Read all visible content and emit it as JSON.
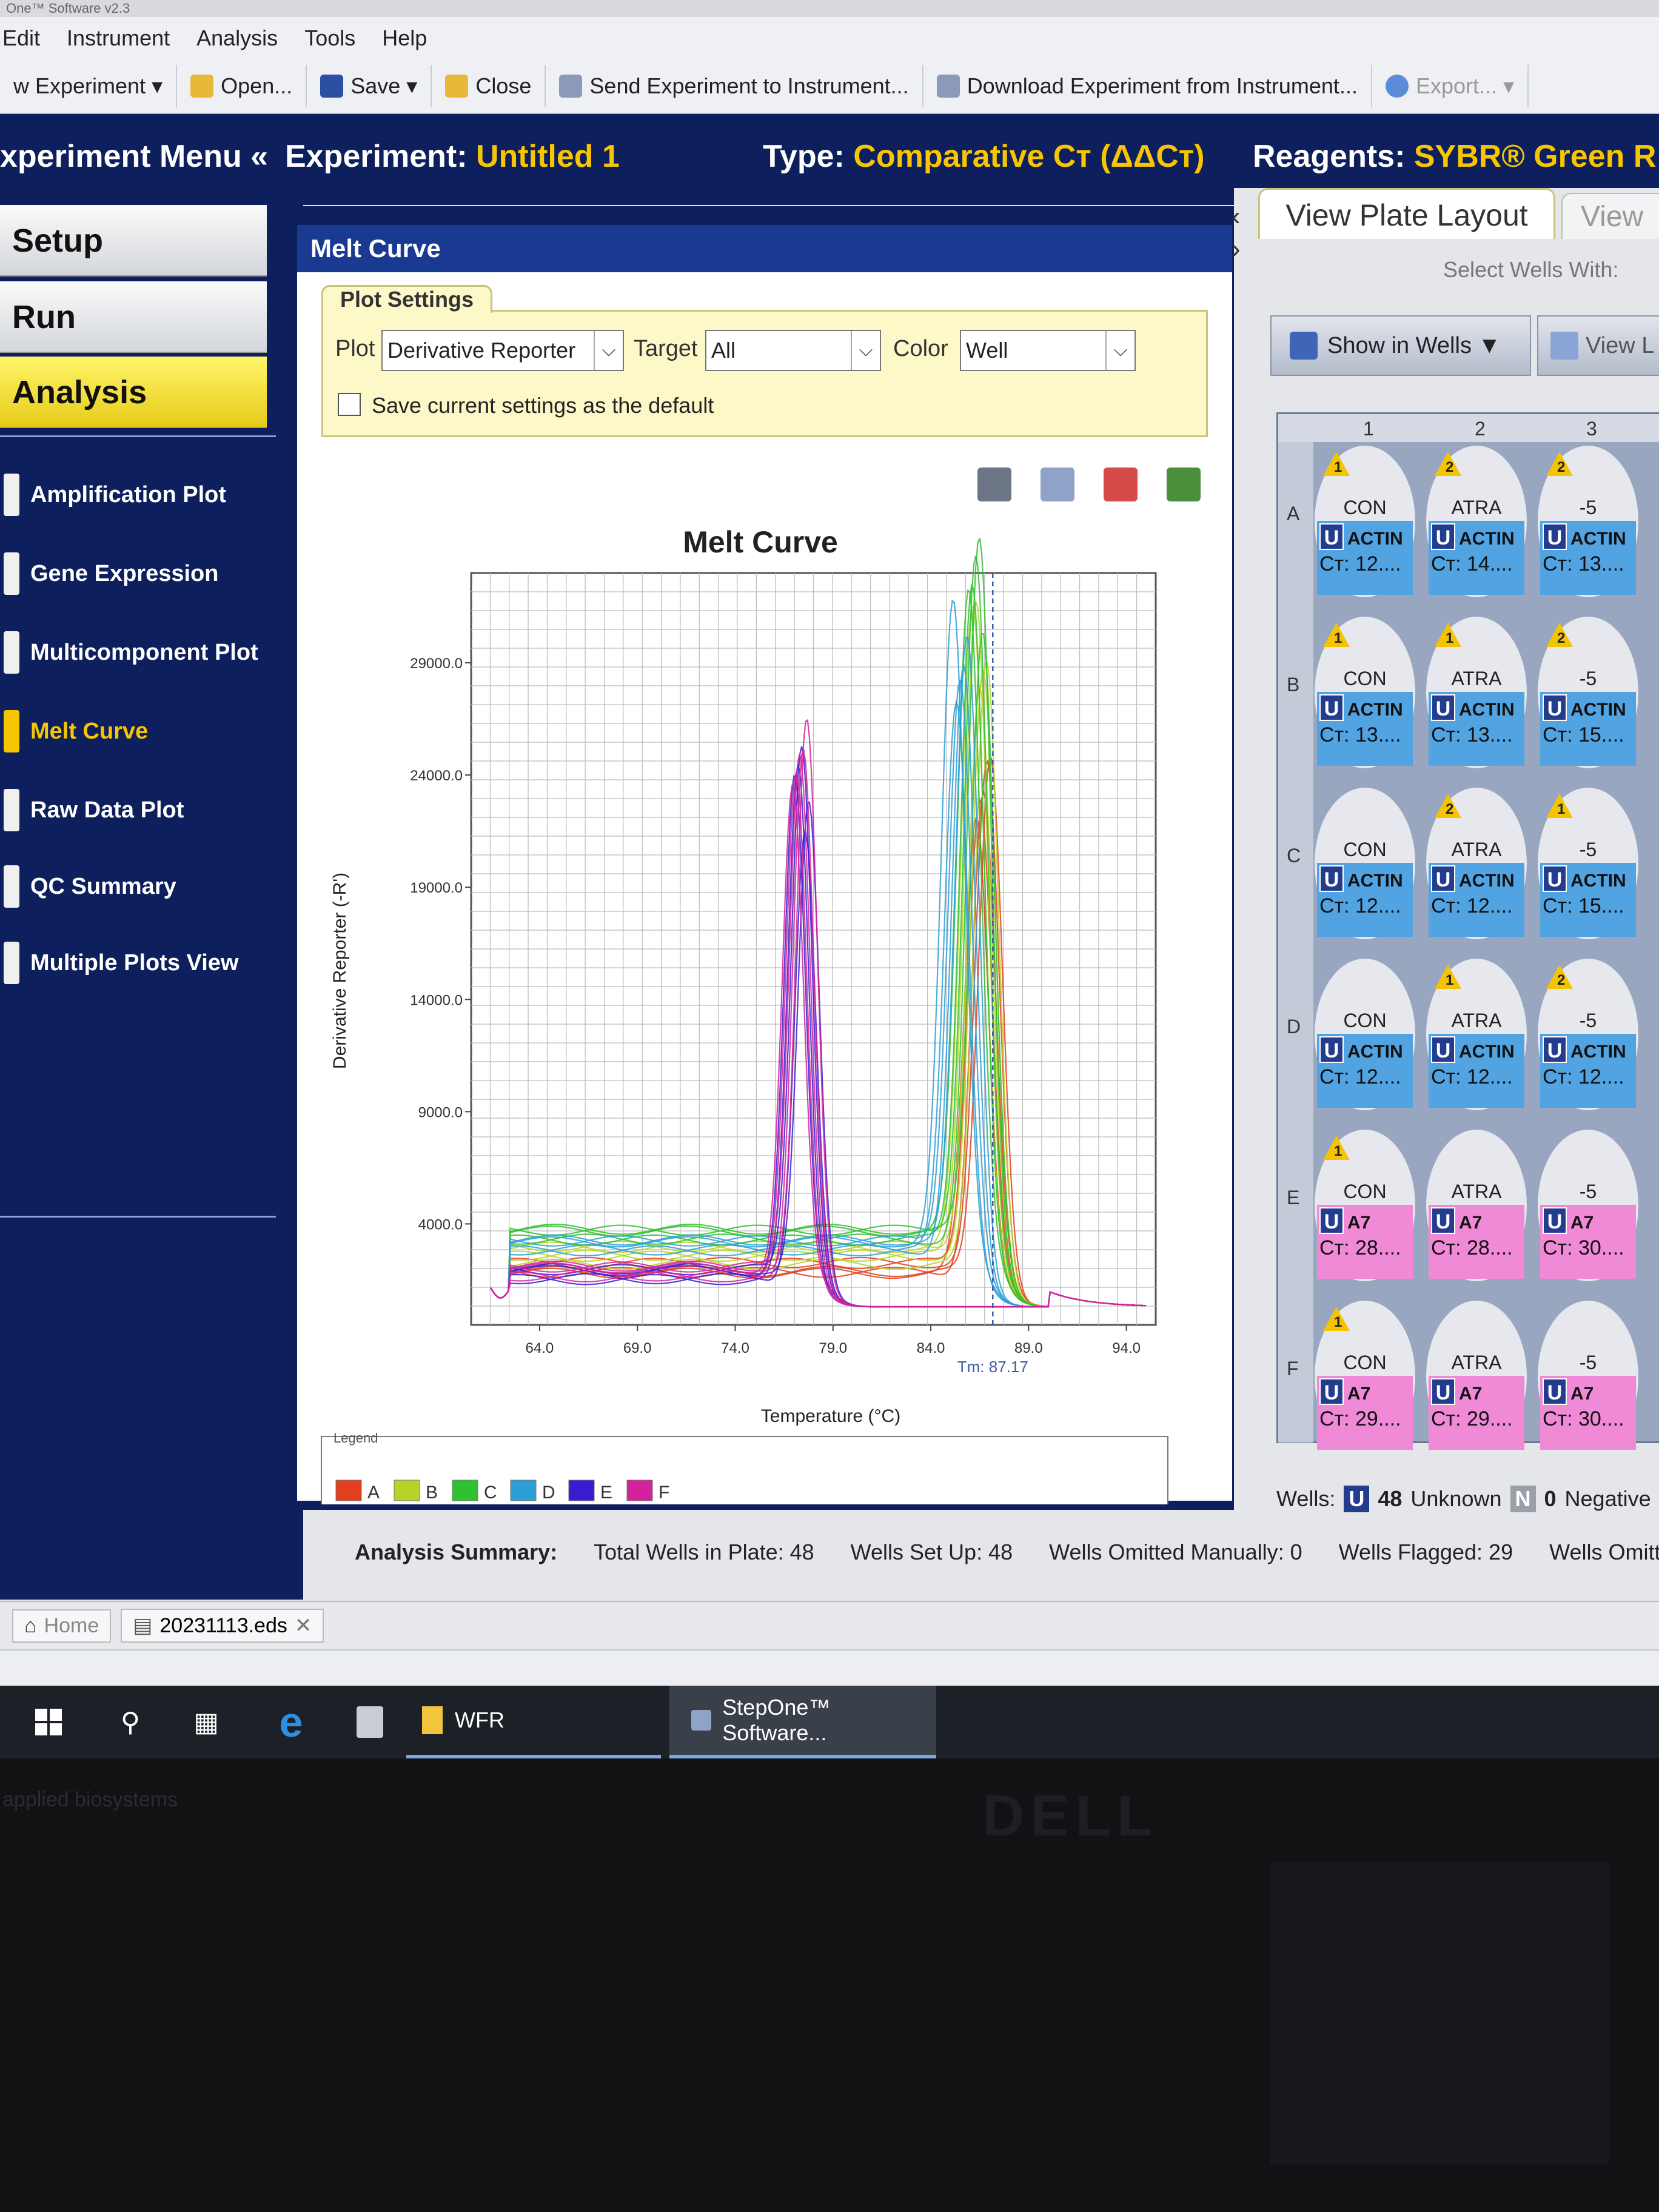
{
  "app": {
    "title": "One™ Software v2.3"
  },
  "menu": [
    "Edit",
    "Instrument",
    "Analysis",
    "Tools",
    "Help"
  ],
  "toolbar": {
    "new_experiment": "w Experiment ▾",
    "open": "Open...",
    "save": "Save ▾",
    "close": "Close",
    "send": "Send Experiment to Instrument...",
    "download": "Download Experiment from Instrument...",
    "export": "Export... ▾"
  },
  "header": {
    "experiment_menu": "xperiment Menu «",
    "experiment_label": "Experiment:",
    "experiment_name": "Untitled 1",
    "type_label": "Type:",
    "type_value": "Comparative Cт (ΔΔCт)",
    "reagents_label": "Reagents:",
    "reagents_value": "SYBR® Green R"
  },
  "sidebar": {
    "nav": [
      "Setup",
      "Run",
      "Analysis"
    ],
    "analysis": [
      "Amplification Plot",
      "Gene Expression",
      "Multicomponent Plot",
      "Melt Curve",
      "Raw Data Plot",
      "QC Summary",
      "Multiple Plots View"
    ],
    "collapse": "«"
  },
  "panel": {
    "title": "Melt Curve",
    "plot_settings": {
      "label": "Plot Settings",
      "plot_label": "Plot",
      "plot_value": "Derivative Reporter",
      "target_label": "Target",
      "target_value": "All",
      "color_label": "Color",
      "color_value": "Well",
      "save_default": "Save current settings as the default"
    }
  },
  "chart_data": {
    "type": "line",
    "title": "Melt Curve",
    "xlabel": "Temperature (°C)",
    "ylabel": "Derivative Reporter (-R')",
    "xlim": [
      60.5,
      95.5
    ],
    "ylim": [
      -500,
      33000
    ],
    "xticks": [
      64.0,
      69.0,
      74.0,
      79.0,
      84.0,
      89.0,
      94.0
    ],
    "xtick_labels": [
      "64.0",
      "69.0",
      "74.0",
      "79.0",
      "84.0",
      "89.0",
      "94.0"
    ],
    "yticks": [
      4000,
      9000,
      14000,
      19000,
      24000,
      29000
    ],
    "ytick_labels": [
      "4000.0",
      "9000.0",
      "14000.0",
      "19000.0",
      "24000.0",
      "29000.0"
    ],
    "grid": true,
    "tm_marker": {
      "x": 87.17,
      "label": "Tm: 87.17"
    },
    "legend": {
      "title": "Legend",
      "position": "bottom"
    },
    "series": [
      {
        "name": "A",
        "color": "#e0401e",
        "peak_temp": 86.7,
        "peak_height": 24000,
        "baseline": 2200
      },
      {
        "name": "B",
        "color": "#b7d32a",
        "peak_temp": 86.5,
        "peak_height": 30000,
        "baseline": 2600
      },
      {
        "name": "C",
        "color": "#2fc12f",
        "peak_temp": 86.3,
        "peak_height": 32000,
        "baseline": 3400
      },
      {
        "name": "D",
        "color": "#2b9fd6",
        "peak_temp": 85.5,
        "peak_height": 28500,
        "baseline": 3000
      },
      {
        "name": "E",
        "color": "#3a1cd0",
        "peak_temp": 77.4,
        "peak_height": 23500,
        "baseline": 1800
      },
      {
        "name": "F",
        "color": "#d4229c",
        "peak_temp": 77.3,
        "peak_height": 24500,
        "baseline": 2000
      }
    ]
  },
  "plate": {
    "tab_active": "View Plate Layout",
    "tab_inactive": "View",
    "select_wells": "Select Wells With:",
    "show_in_wells": "Show in Wells ▼",
    "view_legend": "View L",
    "columns": [
      "1",
      "2",
      "3"
    ],
    "rows": [
      {
        "label": "A",
        "wells": [
          {
            "flag": "1",
            "sample": "CON",
            "target": "ACTIN",
            "ct": "Cт: 12....",
            "color": "#52a3e2"
          },
          {
            "flag": "2",
            "sample": "ATRA",
            "target": "ACTIN",
            "ct": "Cт: 14....",
            "color": "#52a3e2"
          },
          {
            "flag": "2",
            "sample": "-5",
            "target": "ACTIN",
            "ct": "Cт: 13....",
            "color": "#52a3e2"
          }
        ]
      },
      {
        "label": "B",
        "wells": [
          {
            "flag": "1",
            "sample": "CON",
            "target": "ACTIN",
            "ct": "Cт: 13....",
            "color": "#52a3e2"
          },
          {
            "flag": "1",
            "sample": "ATRA",
            "target": "ACTIN",
            "ct": "Cт: 13....",
            "color": "#52a3e2"
          },
          {
            "flag": "2",
            "sample": "-5",
            "target": "ACTIN",
            "ct": "Cт: 15....",
            "color": "#52a3e2"
          }
        ]
      },
      {
        "label": "C",
        "wells": [
          {
            "flag": "",
            "sample": "CON",
            "target": "ACTIN",
            "ct": "Cт: 12....",
            "color": "#52a3e2"
          },
          {
            "flag": "2",
            "sample": "ATRA",
            "target": "ACTIN",
            "ct": "Cт: 12....",
            "color": "#52a3e2"
          },
          {
            "flag": "1",
            "sample": "-5",
            "target": "ACTIN",
            "ct": "Cт: 15....",
            "color": "#52a3e2"
          }
        ]
      },
      {
        "label": "D",
        "wells": [
          {
            "flag": "",
            "sample": "CON",
            "target": "ACTIN",
            "ct": "Cт: 12....",
            "color": "#52a3e2"
          },
          {
            "flag": "1",
            "sample": "ATRA",
            "target": "ACTIN",
            "ct": "Cт: 12....",
            "color": "#52a3e2"
          },
          {
            "flag": "2",
            "sample": "-5",
            "target": "ACTIN",
            "ct": "Cт: 12....",
            "color": "#52a3e2"
          }
        ]
      },
      {
        "label": "E",
        "wells": [
          {
            "flag": "1",
            "sample": "CON",
            "target": "A7",
            "ct": "Cт: 28....",
            "color": "#f08ad6"
          },
          {
            "flag": "",
            "sample": "ATRA",
            "target": "A7",
            "ct": "Cт: 28....",
            "color": "#f08ad6"
          },
          {
            "flag": "",
            "sample": "-5",
            "target": "A7",
            "ct": "Cт: 30....",
            "color": "#f08ad6"
          }
        ]
      },
      {
        "label": "F",
        "wells": [
          {
            "flag": "1",
            "sample": "CON",
            "target": "A7",
            "ct": "Cт: 29....",
            "color": "#f08ad6"
          },
          {
            "flag": "",
            "sample": "ATRA",
            "target": "A7",
            "ct": "Cт: 29....",
            "color": "#f08ad6"
          },
          {
            "flag": "",
            "sample": "-5",
            "target": "A7",
            "ct": "Cт: 30....",
            "color": "#f08ad6"
          }
        ]
      }
    ],
    "counts": {
      "label": "Wells:",
      "unknown_count": "48",
      "unknown_label": "Unknown",
      "negative_count": "0",
      "negative_label": "Negative"
    }
  },
  "summary": {
    "label": "Analysis Summary:",
    "total_wells": "Total Wells in Plate: 48",
    "wells_set_up": "Wells Set Up: 48",
    "wells_omitted_manually": "Wells Omitted Manually: 0",
    "wells_flagged": "Wells Flagged: 29",
    "wells_omitted_by": "Wells Omitted by"
  },
  "tabs": {
    "home": "Home",
    "file": "20231113.eds"
  },
  "taskbar": [
    "WFR",
    "StepOne™ Software..."
  ],
  "bezel": {
    "brand": "DELL",
    "sticker": "applied biosystems"
  }
}
